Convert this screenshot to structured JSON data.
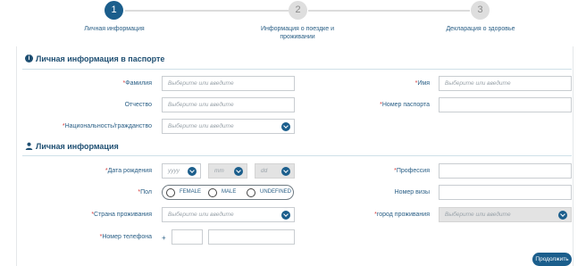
{
  "stepper": {
    "steps": [
      {
        "number": "1",
        "label": "Личная информация",
        "state": "active"
      },
      {
        "number": "2",
        "label_line1": "Информация о поездке и",
        "label_line2": "проживании",
        "state": "inactive"
      },
      {
        "number": "3",
        "label": "Декларация о здоровье",
        "state": "inactive"
      }
    ]
  },
  "passport_section": {
    "title": "Личная информация в паспорте",
    "icon": "info-icon",
    "fields": {
      "surname": {
        "label": "Фамилия",
        "required": "*",
        "placeholder": "Выберите или введите"
      },
      "name": {
        "label": "Имя",
        "required": "*",
        "placeholder": "Выберите или введите"
      },
      "patronymic": {
        "label": "Отчество",
        "placeholder": "Выберите или введите"
      },
      "passport_number": {
        "label": "Номер паспорта",
        "required": "*",
        "value": ""
      },
      "nationality": {
        "label": "Национальность/гражданство",
        "required": "*",
        "placeholder": "Выберите или введите"
      }
    }
  },
  "personal_section": {
    "title": "Личная информация",
    "icon": "person-icon",
    "fields": {
      "birth_date": {
        "label": "Дата рождения",
        "required": "*",
        "year": "yyyy",
        "month": "mm",
        "day": "dd"
      },
      "profession": {
        "label": "Профессия",
        "required": "*",
        "value": ""
      },
      "gender": {
        "label": "Пол",
        "required": "*",
        "options": [
          "FEMALE",
          "MALE",
          "UNDEFINED"
        ]
      },
      "visa_number": {
        "label": "Номер визы",
        "value": ""
      },
      "country": {
        "label": "Страна проживания",
        "required": "*",
        "placeholder": "Выберите или введите"
      },
      "city": {
        "label": "город проживания",
        "required": "*",
        "placeholder": "Выберите или введите"
      },
      "phone": {
        "label": "Номер телефона",
        "required": "*",
        "prefix": "+"
      }
    }
  },
  "actions": {
    "continue_label": "Продолжить"
  },
  "colors": {
    "primary": "#1b5e8c",
    "required": "#d43b3b"
  }
}
